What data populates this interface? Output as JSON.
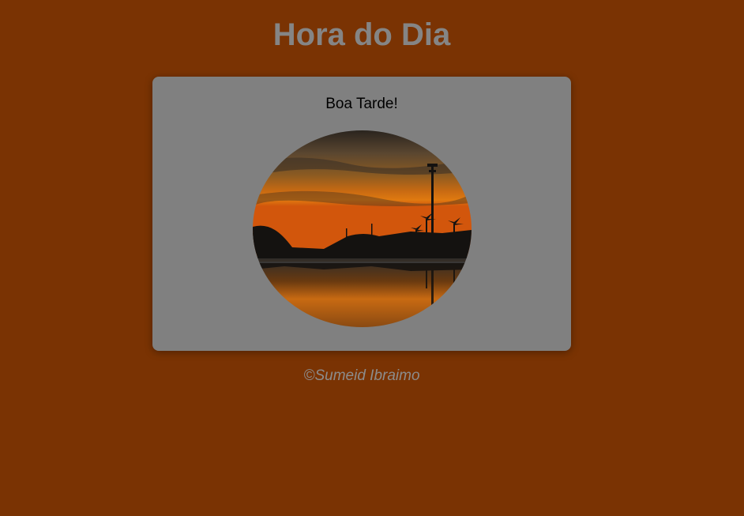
{
  "header": {
    "title": "Hora do Dia"
  },
  "card": {
    "greeting": "Boa Tarde!",
    "image_subject": "sunset-waterfront-photo"
  },
  "footer": {
    "credit": "©Sumeid Ibraimo"
  },
  "colors": {
    "background": "#7a3303",
    "card": "#808080",
    "title": "#858585",
    "footer": "#8c8c8c"
  }
}
